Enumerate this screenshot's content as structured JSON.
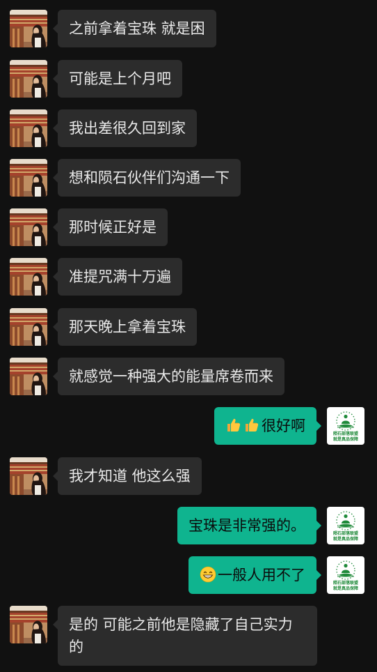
{
  "colors": {
    "background": "#111111",
    "incoming_bubble": "#2c2c2c",
    "outgoing_bubble": "#0fb48f",
    "incoming_text": "#e9e9e9",
    "outgoing_text": "#0b0b0b"
  },
  "contact_avatar": {
    "icon": "contact-avatar-photo"
  },
  "self_avatar": {
    "icon": "meditation-logo-avatar",
    "logo_line1": "陨石部落联盟",
    "logo_line2": "就是真品保障"
  },
  "messages": [
    {
      "from": "contact",
      "text": "之前拿着宝珠 就是困"
    },
    {
      "from": "contact",
      "text": "可能是上个月吧"
    },
    {
      "from": "contact",
      "text": "我出差很久回到家"
    },
    {
      "from": "contact",
      "text": "想和陨石伙伴们沟通一下"
    },
    {
      "from": "contact",
      "text": "那时候正好是"
    },
    {
      "from": "contact",
      "text": "准提咒满十万遍"
    },
    {
      "from": "contact",
      "text": "那天晚上拿着宝珠"
    },
    {
      "from": "contact",
      "text": "就感觉一种强大的能量席卷而来"
    },
    {
      "from": "self",
      "emoji": [
        "thumbs-up-icon",
        "thumbs-up-icon"
      ],
      "text": "很好啊"
    },
    {
      "from": "contact",
      "text": "我才知道 他这么强"
    },
    {
      "from": "self",
      "text": "宝珠是非常强的。"
    },
    {
      "from": "self",
      "emoji": [
        "grin-face-icon"
      ],
      "text": "一般人用不了"
    },
    {
      "from": "contact",
      "text": "是的 可能之前他是隐藏了自己实力的"
    }
  ]
}
